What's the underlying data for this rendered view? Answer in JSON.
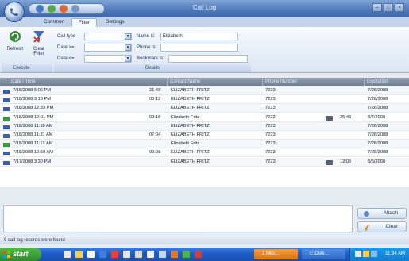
{
  "window": {
    "title": "Call Log",
    "min_label": "–",
    "max_label": "□",
    "close_label": "×"
  },
  "ribbon_tabs": [
    "Common",
    "Filter",
    "Settings"
  ],
  "active_tab": "Filter",
  "execute_group": {
    "refresh_label": "Refresh",
    "clear_filter_label_1": "Clear",
    "clear_filter_label_2": "Filter",
    "footer": "Execute"
  },
  "details_group": {
    "call_type_label": "Call type",
    "date_from_label": "Date >=",
    "date_to_label": "Date <=",
    "name_label": "Name is:",
    "name_value": "Elizabeth",
    "phone_label": "Phone is:",
    "phone_value": "",
    "bookmark_label": "Bookmark is:",
    "bookmark_value": "",
    "footer": "Details"
  },
  "grid": {
    "columns": [
      "Date / Time",
      "Contact Name",
      "Phone Number",
      "Expiration"
    ],
    "rows": [
      {
        "type": "out",
        "datetime": "7/18/2008 5:06 PM",
        "duration": "21:48",
        "name": "ELIZABETH FRITZ",
        "phone": "7223",
        "attach": "",
        "attach_len": "",
        "expiration": "7/28/2008"
      },
      {
        "type": "out",
        "datetime": "7/18/2008 3:19 PM",
        "duration": "00:12",
        "name": "ELIZABETH FRITZ",
        "phone": "7223",
        "attach": "",
        "attach_len": "",
        "expiration": "7/28/2008"
      },
      {
        "type": "out",
        "datetime": "7/18/2008 12:33 PM",
        "duration": "",
        "name": "ELIZABETH FRITZ",
        "phone": "7223",
        "attach": "",
        "attach_len": "",
        "expiration": "7/28/2008"
      },
      {
        "type": "in",
        "datetime": "7/18/2008 12:01 PM",
        "duration": "00:18",
        "name": "Elizabeth Fritz",
        "phone": "7223",
        "attach": "yes",
        "attach_len": "25:49",
        "expiration": "8/7/2008"
      },
      {
        "type": "out",
        "datetime": "7/18/2008 11:38 AM",
        "duration": "",
        "name": "ELIZABETH FRITZ",
        "phone": "7223",
        "attach": "",
        "attach_len": "",
        "expiration": "7/28/2008"
      },
      {
        "type": "out",
        "datetime": "7/18/2008 11:31 AM",
        "duration": "07:04",
        "name": "ELIZABETH FRITZ",
        "phone": "7223",
        "attach": "",
        "attach_len": "",
        "expiration": "7/28/2008"
      },
      {
        "type": "in",
        "datetime": "7/18/2008 11:12 AM",
        "duration": "",
        "name": "Elizabeth Fritz",
        "phone": "7223",
        "attach": "",
        "attach_len": "",
        "expiration": "7/28/2008"
      },
      {
        "type": "out",
        "datetime": "7/18/2008 10:58 AM",
        "duration": "00:08",
        "name": "ELIZABETH FRITZ",
        "phone": "7223",
        "attach": "",
        "attach_len": "",
        "expiration": "7/28/2008"
      },
      {
        "type": "out",
        "datetime": "7/17/2008 3:30 PM",
        "duration": "",
        "name": "ELIZABETH FRITZ",
        "phone": "7223",
        "attach": "yes",
        "attach_len": "12:05",
        "expiration": "8/6/2008"
      }
    ]
  },
  "side_buttons": {
    "attach": "Attach",
    "clear": "Clear"
  },
  "status": "9 call log records were found",
  "taskbar": {
    "start": "start",
    "tasks": [
      "2 Micr...",
      "c:\\Dele..."
    ],
    "clock": "11:34 AM"
  }
}
